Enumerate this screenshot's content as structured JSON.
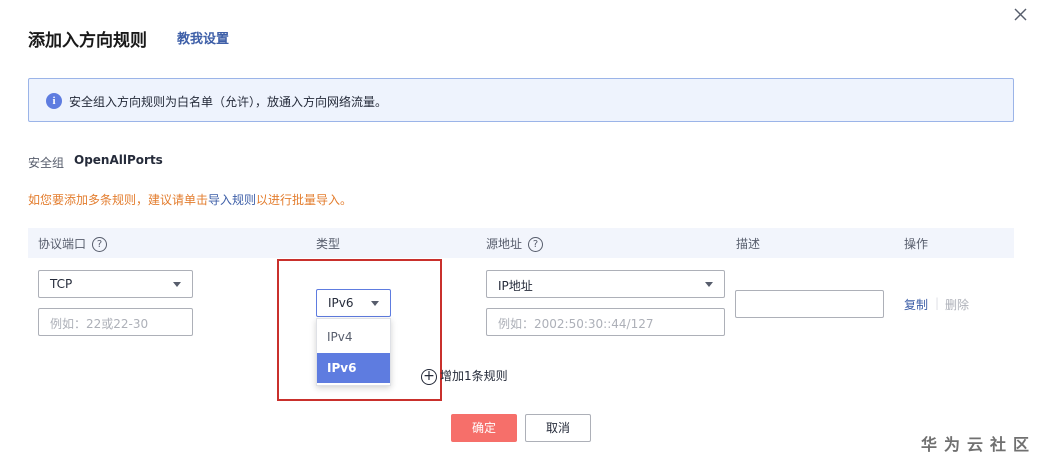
{
  "dialog": {
    "title": "添加入方向规则",
    "help_link": "教我设置"
  },
  "info": {
    "text": "安全组入方向规则为白名单（允许），放通入方向网络流量。"
  },
  "security_group": {
    "label": "安全组",
    "value": "OpenAllPorts"
  },
  "hint": {
    "prefix": "如您要添加多条规则，建议请单击",
    "link": "导入规则",
    "suffix": "以进行批量导入。"
  },
  "table": {
    "headers": {
      "protocol_port": "协议端口",
      "type": "类型",
      "source": "源地址",
      "description": "描述",
      "actions": "操作"
    },
    "row": {
      "protocol": "TCP",
      "port_placeholder": "例如：22或22-30",
      "type": "IPv6",
      "source_type": "IP地址",
      "source_placeholder": "例如：2002:50:30::44/127",
      "description": "",
      "copy": "复制",
      "delete": "删除"
    },
    "type_options": [
      "IPv4",
      "IPv6"
    ]
  },
  "add_rule": "增加1条规则",
  "buttons": {
    "ok": "确定",
    "cancel": "取消"
  },
  "watermark": "华为云社区",
  "colors": {
    "accent": "#5e7ce0",
    "link": "#3e5fa8",
    "primary_button": "#f66f6a",
    "hint": "#e37d2e",
    "highlight_border": "#c9302c"
  }
}
